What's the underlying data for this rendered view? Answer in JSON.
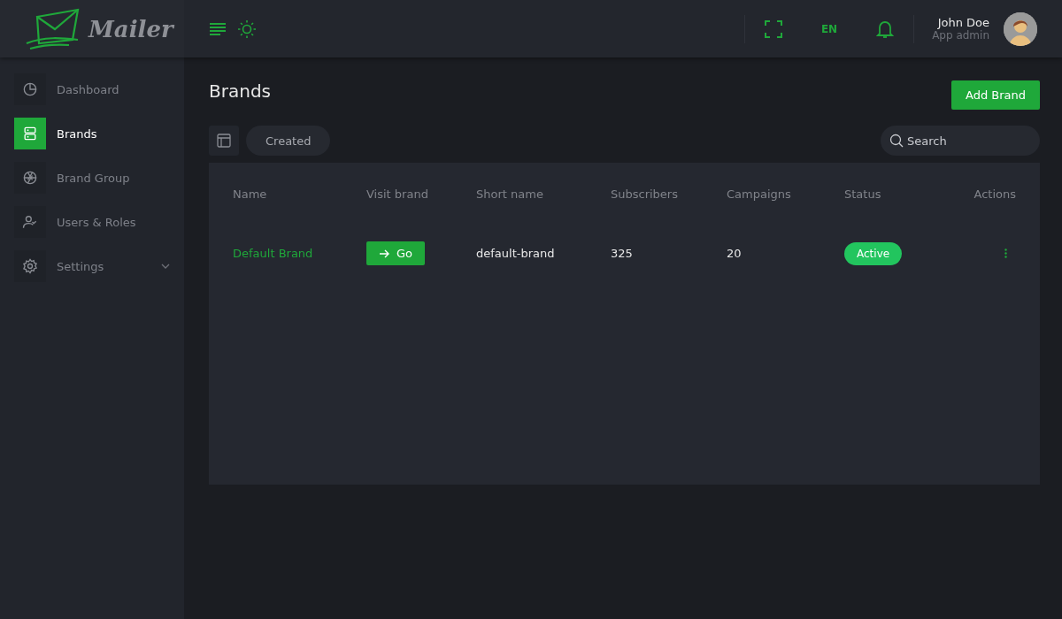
{
  "logo": {
    "text": "Mailer"
  },
  "header": {
    "language": "EN",
    "user": {
      "name": "John Doe",
      "role": "App admin"
    }
  },
  "sidebar": {
    "items": [
      {
        "label": "Dashboard",
        "selected": false
      },
      {
        "label": "Brands",
        "selected": true
      },
      {
        "label": "Brand Group",
        "selected": false
      },
      {
        "label": "Users & Roles",
        "selected": false
      },
      {
        "label": "Settings",
        "selected": false,
        "kind": "expandable",
        "expanded": false
      }
    ]
  },
  "page": {
    "title": "Brands",
    "add_button": "Add Brand"
  },
  "toolbar": {
    "filter": "Created",
    "search": {
      "placeholder": "Search"
    }
  },
  "table": {
    "columns": [
      "Name",
      "Visit brand",
      "Short name",
      "Subscribers",
      "Campaigns",
      "Status",
      "Actions"
    ],
    "rows": [
      {
        "name": "Default Brand",
        "visit": "Go",
        "short_name": "default-brand",
        "subscribers": "325",
        "campaigns": "20",
        "status": "Active"
      }
    ]
  }
}
